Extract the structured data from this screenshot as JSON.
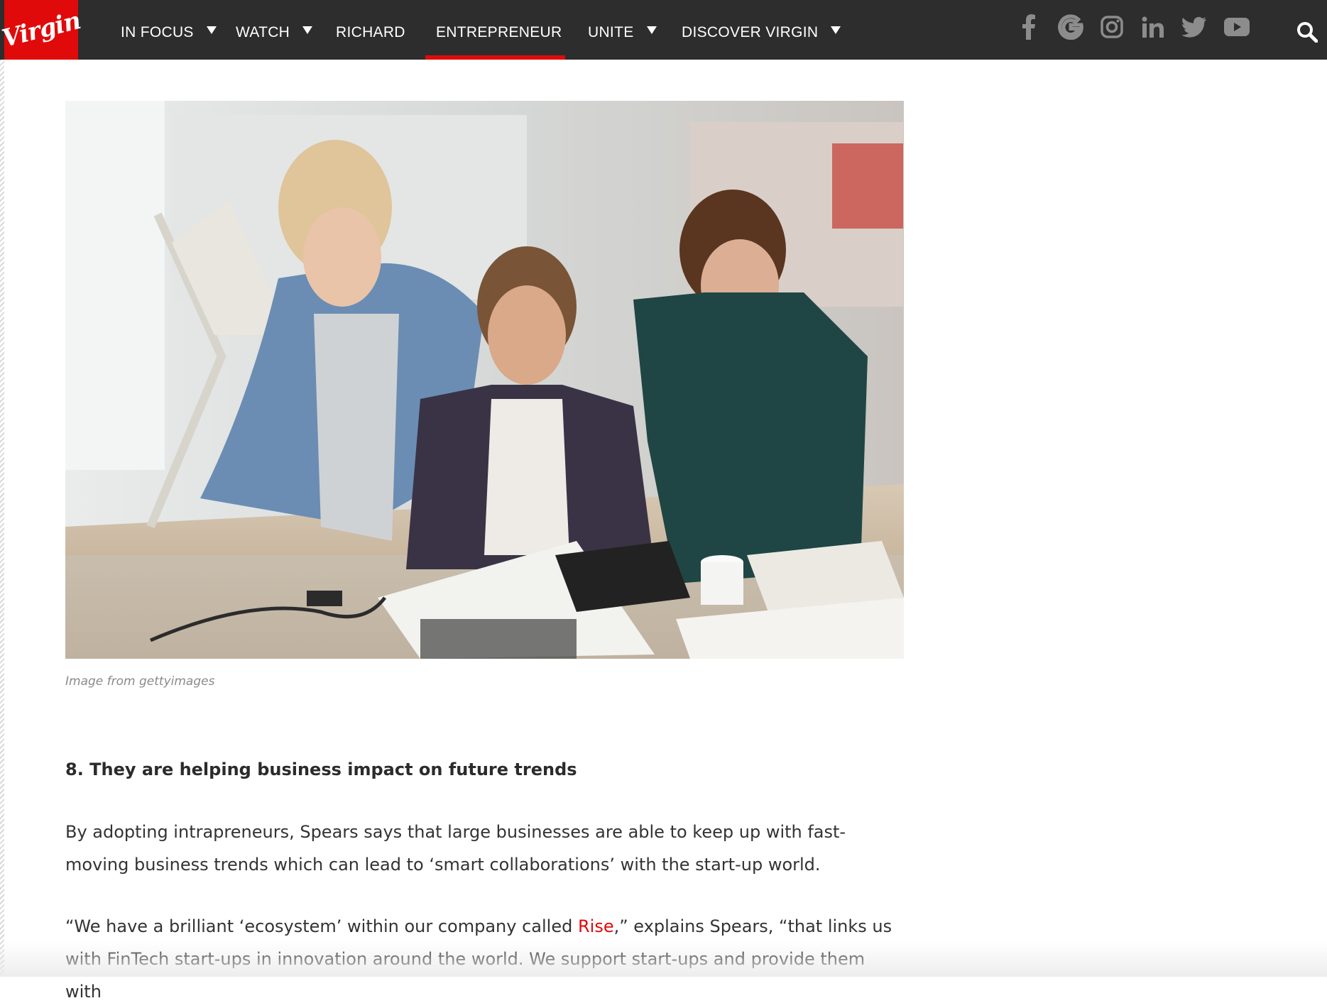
{
  "brand": {
    "logo_text": "Virgin",
    "accent": "#e10a0a",
    "nav_bg": "#2d2d2d"
  },
  "nav": {
    "items": [
      {
        "label": "IN FOCUS",
        "dropdown": true
      },
      {
        "label": "WATCH",
        "dropdown": true
      },
      {
        "label": "RICHARD",
        "dropdown": false
      },
      {
        "label": "ENTREPRENEUR",
        "dropdown": false,
        "active": true
      },
      {
        "label": "UNITE",
        "dropdown": true
      },
      {
        "label": "DISCOVER VIRGIN",
        "dropdown": true
      }
    ],
    "social": [
      "facebook-icon",
      "google-icon",
      "instagram-icon",
      "linkedin-icon",
      "twitter-icon",
      "youtube-icon"
    ],
    "search_icon": "search-icon"
  },
  "article": {
    "image_caption": "Image from gettyimages",
    "section_heading": "8. They are helping business impact on future trends",
    "para1": "By adopting intrapreneurs, Spears says that large businesses are able to keep up with fast-moving business trends which can lead to ‘smart collaborations’ with the start-up world.",
    "para2_before": "“We have a brilliant ‘ecosystem’ within our company called ",
    "para2_link": "Rise",
    "para2_after": ",” explains Spears, “that links us with FinTech start-ups in innovation around the world. We support start-ups and provide them with"
  }
}
